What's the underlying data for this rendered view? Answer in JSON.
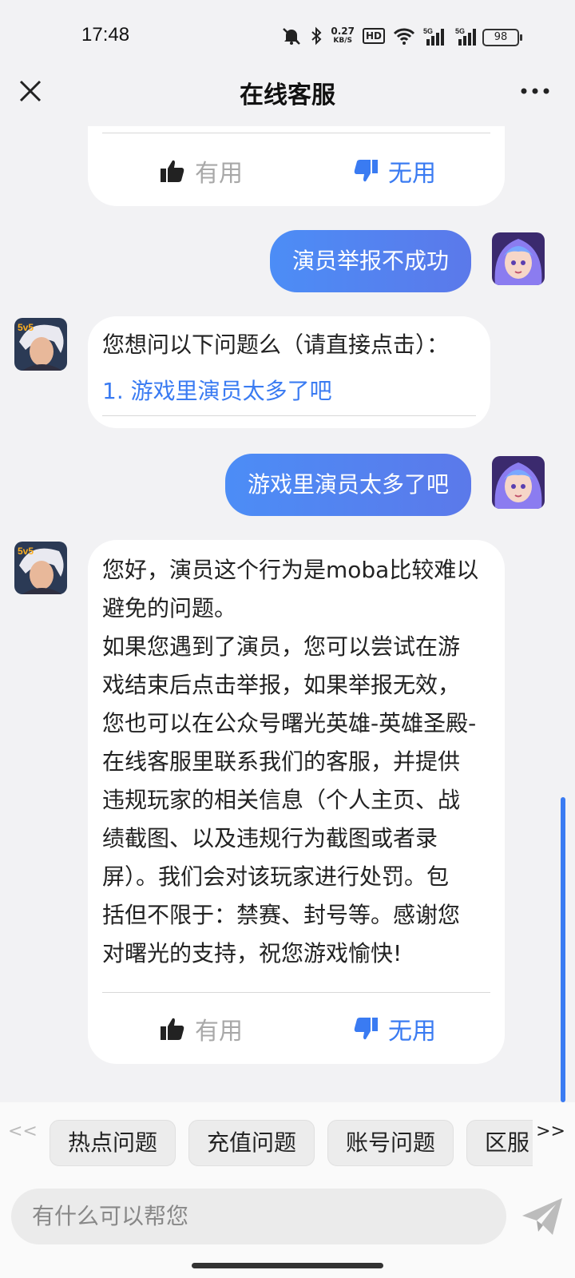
{
  "status_bar": {
    "time": "17:48",
    "net_speed_value": "0.27",
    "net_speed_unit": "KB/S",
    "hd": "HD",
    "battery": "98"
  },
  "header": {
    "title": "在线客服"
  },
  "feedback": {
    "useful": "有用",
    "useless": "无用"
  },
  "messages": {
    "user1": "演员举报不成功",
    "bot1_prompt": "您想问以下问题么（请直接点击）：",
    "bot1_option": "1. 游戏里演员太多了吧",
    "user2": "游戏里演员太多了吧",
    "bot2_lines": [
      "您好，演员这个行为是moba比较难以",
      "避免的问题。",
      "如果您遇到了演员，您可以尝试在游",
      "戏结束后点击举报，如果举报无效，",
      "您也可以在公众号曙光英雄-英雄圣殿-",
      "在线客服里联系我们的客服，并提供",
      "违规玩家的相关信息（个人主页、战",
      "绩截图、以及违规行为截图或者录",
      "屏）。我们会对该玩家进行处罚。包",
      "括但不限于：禁赛、封号等。感谢您",
      "对曙光的支持，祝您游戏愉快!"
    ]
  },
  "bot_avatar_badge": "5v5",
  "quick_bar": {
    "left_arrow": "<<",
    "right_arrow": ">>",
    "items": [
      "热点问题",
      "充值问题",
      "账号问题",
      "区服"
    ]
  },
  "input": {
    "placeholder": "有什么可以帮您"
  },
  "colors": {
    "accent": "#3a7bf2",
    "bubble_start": "#4c8df6",
    "bubble_end": "#5b79ea"
  }
}
